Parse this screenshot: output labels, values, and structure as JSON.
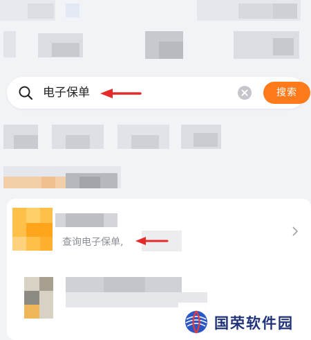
{
  "search": {
    "query": "电子保单",
    "button_label": "搜索"
  },
  "result": {
    "subtitle": "查询电子保单,"
  },
  "watermark": {
    "text": "国荣软件园"
  }
}
